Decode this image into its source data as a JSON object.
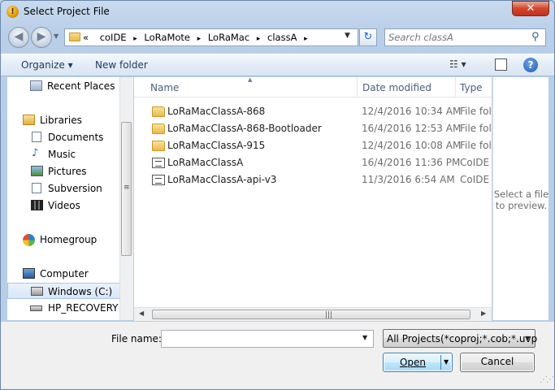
{
  "window": {
    "title": "Select Project File",
    "app_icon_glyph": "!",
    "close_glyph": "✕"
  },
  "nav": {
    "back_glyph": "◀",
    "forward_glyph": "▶",
    "recent_glyph": "▼"
  },
  "address": {
    "overflow": "«",
    "crumbs": [
      "coIDE",
      "LoRaMote",
      "LoRaMac",
      "classA"
    ],
    "separator": "▸",
    "dropdown_glyph": "▼"
  },
  "refresh_glyph": "↻",
  "search": {
    "placeholder": "Search classA",
    "icon_glyph": "⚲"
  },
  "toolbar": {
    "organize_label": "Organize ▾",
    "new_folder_label": "New folder",
    "view_glyph": "☷ ▾",
    "help_glyph": "?"
  },
  "sidebar": {
    "items": [
      {
        "label": "Recent Places",
        "icon": "recent-places-icon"
      },
      {
        "label": "Libraries",
        "icon": "libraries-icon"
      },
      {
        "label": "Documents",
        "icon": "documents-icon"
      },
      {
        "label": "Music",
        "icon": "music-icon"
      },
      {
        "label": "Pictures",
        "icon": "pictures-icon"
      },
      {
        "label": "Subversion",
        "icon": "subversion-icon"
      },
      {
        "label": "Videos",
        "icon": "videos-icon"
      },
      {
        "label": "Homegroup",
        "icon": "homegroup-icon"
      },
      {
        "label": "Computer",
        "icon": "computer-icon"
      },
      {
        "label": "Windows (C:)",
        "icon": "drive-icon",
        "selected": true
      },
      {
        "label": "HP_RECOVERY (D",
        "icon": "drive-icon"
      }
    ],
    "scroll_grip": "≡"
  },
  "files": {
    "columns": [
      "Name",
      "Date modified",
      "Type"
    ],
    "sort_indicator": "▲",
    "rows": [
      {
        "name": "LoRaMacClassA-868",
        "date": "12/4/2016 10:34 AM",
        "type": "File folder",
        "icon": "folder-icon"
      },
      {
        "name": "LoRaMacClassA-868-Bootloader",
        "date": "16/4/2016 12:53 AM",
        "type": "File folder",
        "icon": "folder-icon"
      },
      {
        "name": "LoRaMacClassA-915",
        "date": "12/4/2016 10:08 AM",
        "type": "File folder",
        "icon": "folder-icon"
      },
      {
        "name": "LoRaMacClassA",
        "date": "16/4/2016 11:36 PM",
        "type": "CoIDE Project",
        "icon": "coide-file-icon"
      },
      {
        "name": "LoRaMacClassA-api-v3",
        "date": "11/3/2016 6:54 AM",
        "type": "CoIDE Project",
        "icon": "coide-file-icon"
      }
    ],
    "hscroll_left": "◀",
    "hscroll_right": "▶",
    "hscroll_grip": "|||"
  },
  "preview": {
    "message": "Select a file to preview."
  },
  "footer": {
    "file_name_label": "File name:",
    "file_name_value": "",
    "file_name_dropdown": "▼",
    "filter_value": "All Projects(*coproj;*.cob;*.uvp",
    "filter_dropdown": "▼",
    "open_label": "Open",
    "open_arrow": "▼",
    "cancel_label": "Cancel"
  },
  "colors": {
    "frame": "#bfd3ea",
    "close": "#c7381f",
    "link": "#1e395b",
    "selection": "#d6e6f7"
  }
}
